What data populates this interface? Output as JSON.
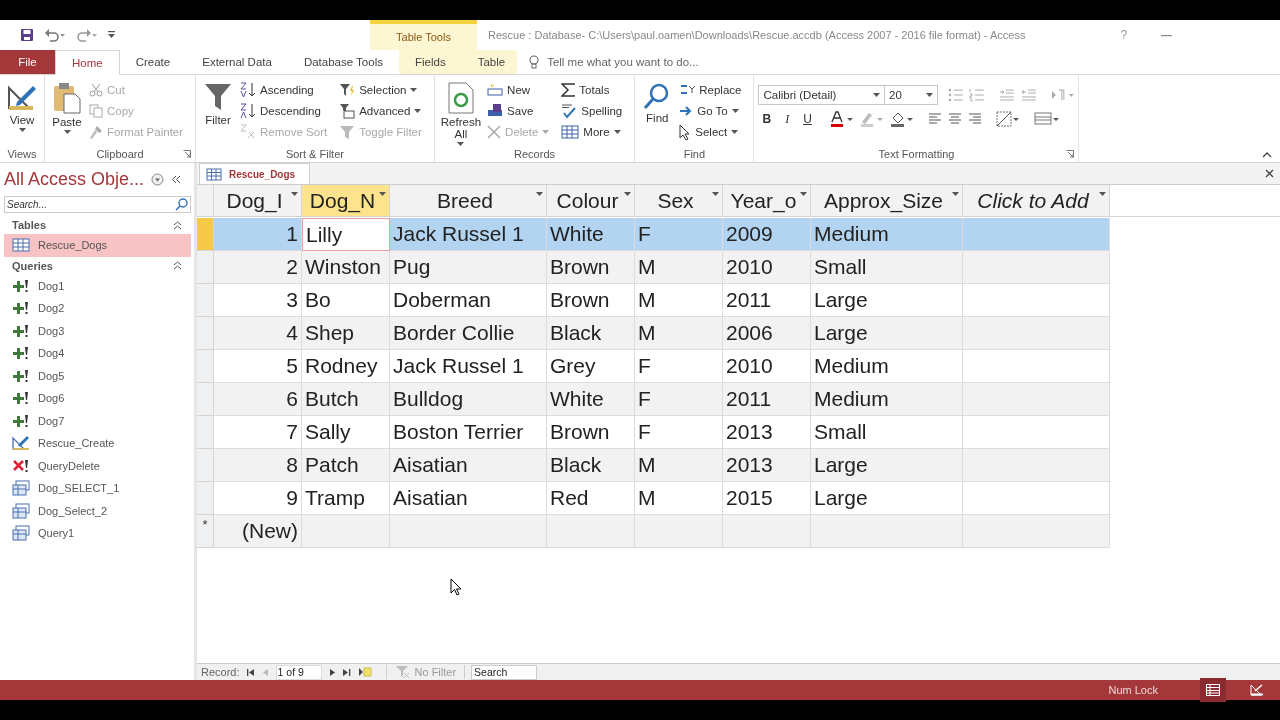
{
  "title_bar": {
    "contextual_label": "Table Tools",
    "title": "Rescue : Database- C:\\Users\\paul.oamen\\Downloads\\Rescue.accdb (Access 2007 - 2016 file format) - Access",
    "help": "?"
  },
  "ribbon_tabs": [
    {
      "label": "File",
      "kind": "file",
      "selected": false
    },
    {
      "label": "Home",
      "kind": "normal",
      "selected": true
    },
    {
      "label": "Create",
      "kind": "normal",
      "selected": false
    },
    {
      "label": "External Data",
      "kind": "normal",
      "selected": false
    },
    {
      "label": "Database Tools",
      "kind": "normal",
      "selected": false
    },
    {
      "label": "Fields",
      "kind": "contextual",
      "selected": false
    },
    {
      "label": "Table",
      "kind": "contextual",
      "selected": false
    }
  ],
  "tell_me": {
    "placeholder": "Tell me what you want to do..."
  },
  "ribbon": {
    "groups": [
      {
        "label": "Views",
        "launcher": false,
        "controls": [
          {
            "label": "View",
            "kind": "large",
            "dropdown": true,
            "disabled": false
          }
        ]
      },
      {
        "label": "Clipboard",
        "launcher": true,
        "controls": [
          {
            "label": "Paste",
            "kind": "large",
            "dropdown": true,
            "disabled": false
          },
          {
            "label": "Cut",
            "kind": "small",
            "dropdown": false,
            "disabled": true
          },
          {
            "label": "Copy",
            "kind": "small",
            "dropdown": false,
            "disabled": true
          },
          {
            "label": "Format Painter",
            "kind": "small",
            "dropdown": false,
            "disabled": true
          }
        ]
      },
      {
        "label": "Sort & Filter",
        "launcher": false,
        "controls": [
          {
            "label": "Filter",
            "kind": "large",
            "dropdown": false,
            "disabled": false
          },
          {
            "label": "Ascending",
            "kind": "small",
            "dropdown": false,
            "disabled": false
          },
          {
            "label": "Descending",
            "kind": "small",
            "dropdown": false,
            "disabled": false
          },
          {
            "label": "Remove Sort",
            "kind": "small",
            "dropdown": false,
            "disabled": true
          },
          {
            "label": "Selection",
            "kind": "small",
            "dropdown": true,
            "disabled": false
          },
          {
            "label": "Advanced",
            "kind": "small",
            "dropdown": true,
            "disabled": false
          },
          {
            "label": "Toggle Filter",
            "kind": "small",
            "dropdown": false,
            "disabled": true
          }
        ]
      },
      {
        "label": "Records",
        "launcher": false,
        "controls": [
          {
            "label": "Refresh\nAll",
            "kind": "large",
            "dropdown": true,
            "disabled": false
          },
          {
            "label": "New",
            "kind": "small",
            "dropdown": false,
            "disabled": false
          },
          {
            "label": "Save",
            "kind": "small",
            "dropdown": false,
            "disabled": false
          },
          {
            "label": "Delete",
            "kind": "small",
            "dropdown": true,
            "disabled": true
          },
          {
            "label": "Totals",
            "kind": "small",
            "dropdown": false,
            "disabled": false
          },
          {
            "label": "Spelling",
            "kind": "small",
            "dropdown": false,
            "disabled": false
          },
          {
            "label": "More",
            "kind": "small",
            "dropdown": true,
            "disabled": false
          }
        ]
      },
      {
        "label": "Find",
        "launcher": false,
        "controls": [
          {
            "label": "Find",
            "kind": "large",
            "dropdown": false,
            "disabled": false
          },
          {
            "label": "Replace",
            "kind": "small",
            "dropdown": false,
            "disabled": false
          },
          {
            "label": "Go To",
            "kind": "small",
            "dropdown": true,
            "disabled": false
          },
          {
            "label": "Select",
            "kind": "small",
            "dropdown": true,
            "disabled": false
          }
        ]
      }
    ]
  },
  "text_formatting": {
    "label": "Text Formatting",
    "font": "Calibri (Detail)",
    "size": "20",
    "format_buttons": [
      {
        "label": "B",
        "kind": "bold"
      },
      {
        "label": "I",
        "kind": "italic"
      },
      {
        "label": "U",
        "kind": "underline"
      }
    ]
  },
  "nav_pane": {
    "title": "All Access Obje...",
    "search_placeholder": "Search...",
    "sections": [
      {
        "label": "Tables",
        "expanded": true,
        "items": [
          {
            "label": "Rescue_Dogs",
            "kind": "table",
            "selected": true
          }
        ]
      },
      {
        "label": "Queries",
        "expanded": true,
        "items": [
          {
            "label": "Dog1",
            "kind": "append",
            "selected": false
          },
          {
            "label": "Dog2",
            "kind": "append",
            "selected": false
          },
          {
            "label": "Dog3",
            "kind": "append",
            "selected": false
          },
          {
            "label": "Dog4",
            "kind": "append",
            "selected": false
          },
          {
            "label": "Dog5",
            "kind": "append",
            "selected": false
          },
          {
            "label": "Dog6",
            "kind": "append",
            "selected": false
          },
          {
            "label": "Dog7",
            "kind": "append",
            "selected": false
          },
          {
            "label": "Rescue_Create",
            "kind": "make-table",
            "selected": false
          },
          {
            "label": "QueryDelete",
            "kind": "delete",
            "selected": false
          },
          {
            "label": "Dog_SELECT_1",
            "kind": "select",
            "selected": false
          },
          {
            "label": "Dog_Select_2",
            "kind": "select",
            "selected": false
          },
          {
            "label": "Query1",
            "kind": "select",
            "selected": false
          }
        ]
      }
    ]
  },
  "datasheet": {
    "tab": "Rescue_Dogs",
    "columns": [
      {
        "label": "Dog_I",
        "kind": "number",
        "selected": false
      },
      {
        "label": "Dog_N",
        "kind": "text",
        "selected": true
      },
      {
        "label": "Breed",
        "kind": "text",
        "selected": false
      },
      {
        "label": "Colour",
        "kind": "text",
        "selected": false
      },
      {
        "label": "Sex",
        "kind": "text",
        "selected": false
      },
      {
        "label": "Year_o",
        "kind": "text",
        "selected": false
      },
      {
        "label": "Approx_Size",
        "kind": "text",
        "selected": false
      },
      {
        "label": "Click to Add",
        "kind": "add",
        "selected": false
      }
    ],
    "rows": [
      {
        "selected": true,
        "cells": [
          "1",
          "Lilly",
          "Jack Russel 1",
          "White",
          "F",
          "2009",
          "Medium"
        ]
      },
      {
        "selected": false,
        "cells": [
          "2",
          "Winston",
          "Pug",
          "Brown",
          "M",
          "2010",
          "Small"
        ]
      },
      {
        "selected": false,
        "cells": [
          "3",
          "Bo",
          "Doberman",
          "Brown",
          "M",
          "2011",
          "Large"
        ]
      },
      {
        "selected": false,
        "cells": [
          "4",
          "Shep",
          "Border Collie",
          "Black",
          "M",
          "2006",
          "Large"
        ]
      },
      {
        "selected": false,
        "cells": [
          "5",
          "Rodney",
          "Jack Russel 1",
          "Grey",
          "F",
          "2010",
          "Medium"
        ]
      },
      {
        "selected": false,
        "cells": [
          "6",
          "Butch",
          "Bulldog",
          "White",
          "F",
          "2011",
          "Medium"
        ]
      },
      {
        "selected": false,
        "cells": [
          "7",
          "Sally",
          "Boston Terrier",
          "Brown",
          "F",
          "2013",
          "Small"
        ]
      },
      {
        "selected": false,
        "cells": [
          "8",
          "Patch",
          "Aisatian",
          "Black",
          "M",
          "2013",
          "Large"
        ]
      },
      {
        "selected": false,
        "cells": [
          "9",
          "Tramp",
          "Aisatian",
          "Red",
          "M",
          "2015",
          "Large"
        ]
      }
    ],
    "new_row": {
      "marker": "*",
      "label": "(New)"
    }
  },
  "record_nav": {
    "label": "Record:",
    "position": "1 of 9",
    "filter": "No Filter",
    "search_placeholder": "Search"
  },
  "status_bar": {
    "num_lock": "Num Lock"
  }
}
